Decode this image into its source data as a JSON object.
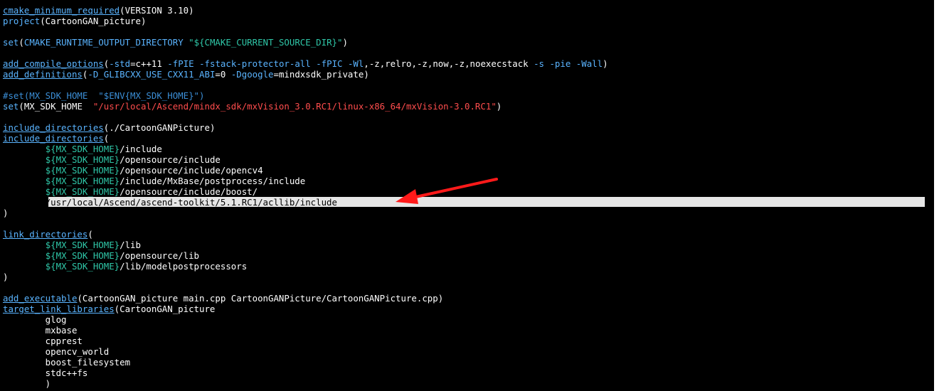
{
  "annotation": {
    "arrow_color": "#ff1a1a"
  },
  "colors": {
    "background": "#000000",
    "function": "#5ab4ff",
    "variable": "#2fc7a8",
    "string": "#ff4d4d",
    "comment": "#3b8ed6",
    "highlight": "#e6e6e6"
  },
  "code": {
    "l01": [
      "cmake_minimum_required",
      "(VERSION 3.10)"
    ],
    "l02": [
      "project",
      "(CartoonGAN_picture)"
    ],
    "l04": [
      "set",
      "(",
      "CMAKE_RUNTIME_OUTPUT_DIRECTORY",
      " ",
      "\"${CMAKE_CURRENT_SOURCE_DIR}\"",
      ")"
    ],
    "l06": [
      "add_compile_options",
      "(",
      "-std",
      "=c++11 ",
      "-fPIE",
      " ",
      "-fstack-protector-all",
      " ",
      "-fPIC",
      " ",
      "-Wl",
      ",-z,relro,-z,now,-z,noexecstack ",
      "-s",
      " ",
      "-pie",
      " ",
      "-Wall",
      ")"
    ],
    "l07": [
      "add_definitions",
      "(",
      "-D_GLIBCXX_USE_CXX11_ABI",
      "=0 ",
      "-Dgoogle",
      "=mindxsdk_private)"
    ],
    "l09": "#set(MX_SDK_HOME  \"$ENV{MX_SDK_HOME}\")",
    "l10": [
      "set",
      "(MX_SDK_HOME  ",
      "\"/usr/local/Ascend/mindx_sdk/mxVision_3.0.RC1/linux-x86_64/mxVision-3.0.RC1\"",
      ")"
    ],
    "l12": [
      "include_directories",
      "(./CartoonGANPicture)"
    ],
    "l13": [
      "include_directories",
      "("
    ],
    "l14": [
      "        ",
      "${MX_SDK_HOME}",
      "/include"
    ],
    "l15": [
      "        ",
      "${MX_SDK_HOME}",
      "/opensource/include"
    ],
    "l16": [
      "        ",
      "${MX_SDK_HOME}",
      "/opensource/include/opencv4"
    ],
    "l17": [
      "        ",
      "${MX_SDK_HOME}",
      "/include/MxBase/postprocess/include"
    ],
    "l18": [
      "        ",
      "${MX_SDK_HOME}",
      "/opensource/include/boost/"
    ],
    "l19": "/usr/local/Ascend/ascend-toolkit/5.1.RC1/acllib/include",
    "l20": ")",
    "l22": [
      "link_directories",
      "("
    ],
    "l23": [
      "        ",
      "${MX_SDK_HOME}",
      "/lib"
    ],
    "l24": [
      "        ",
      "${MX_SDK_HOME}",
      "/opensource/lib"
    ],
    "l25": [
      "        ",
      "${MX_SDK_HOME}",
      "/lib/modelpostprocessors"
    ],
    "l26": ")",
    "l28": [
      "add_executable",
      "(CartoonGAN_picture main.cpp CartoonGANPicture/CartoonGANPicture.cpp)"
    ],
    "l29": [
      "target_link_libraries",
      "(CartoonGAN_picture"
    ],
    "l30": "        glog",
    "l31": "        mxbase",
    "l32": "        cpprest",
    "l33": "        opencv_world",
    "l34": "        boost_filesystem",
    "l35": "        stdc++fs",
    "l36": "        )"
  }
}
